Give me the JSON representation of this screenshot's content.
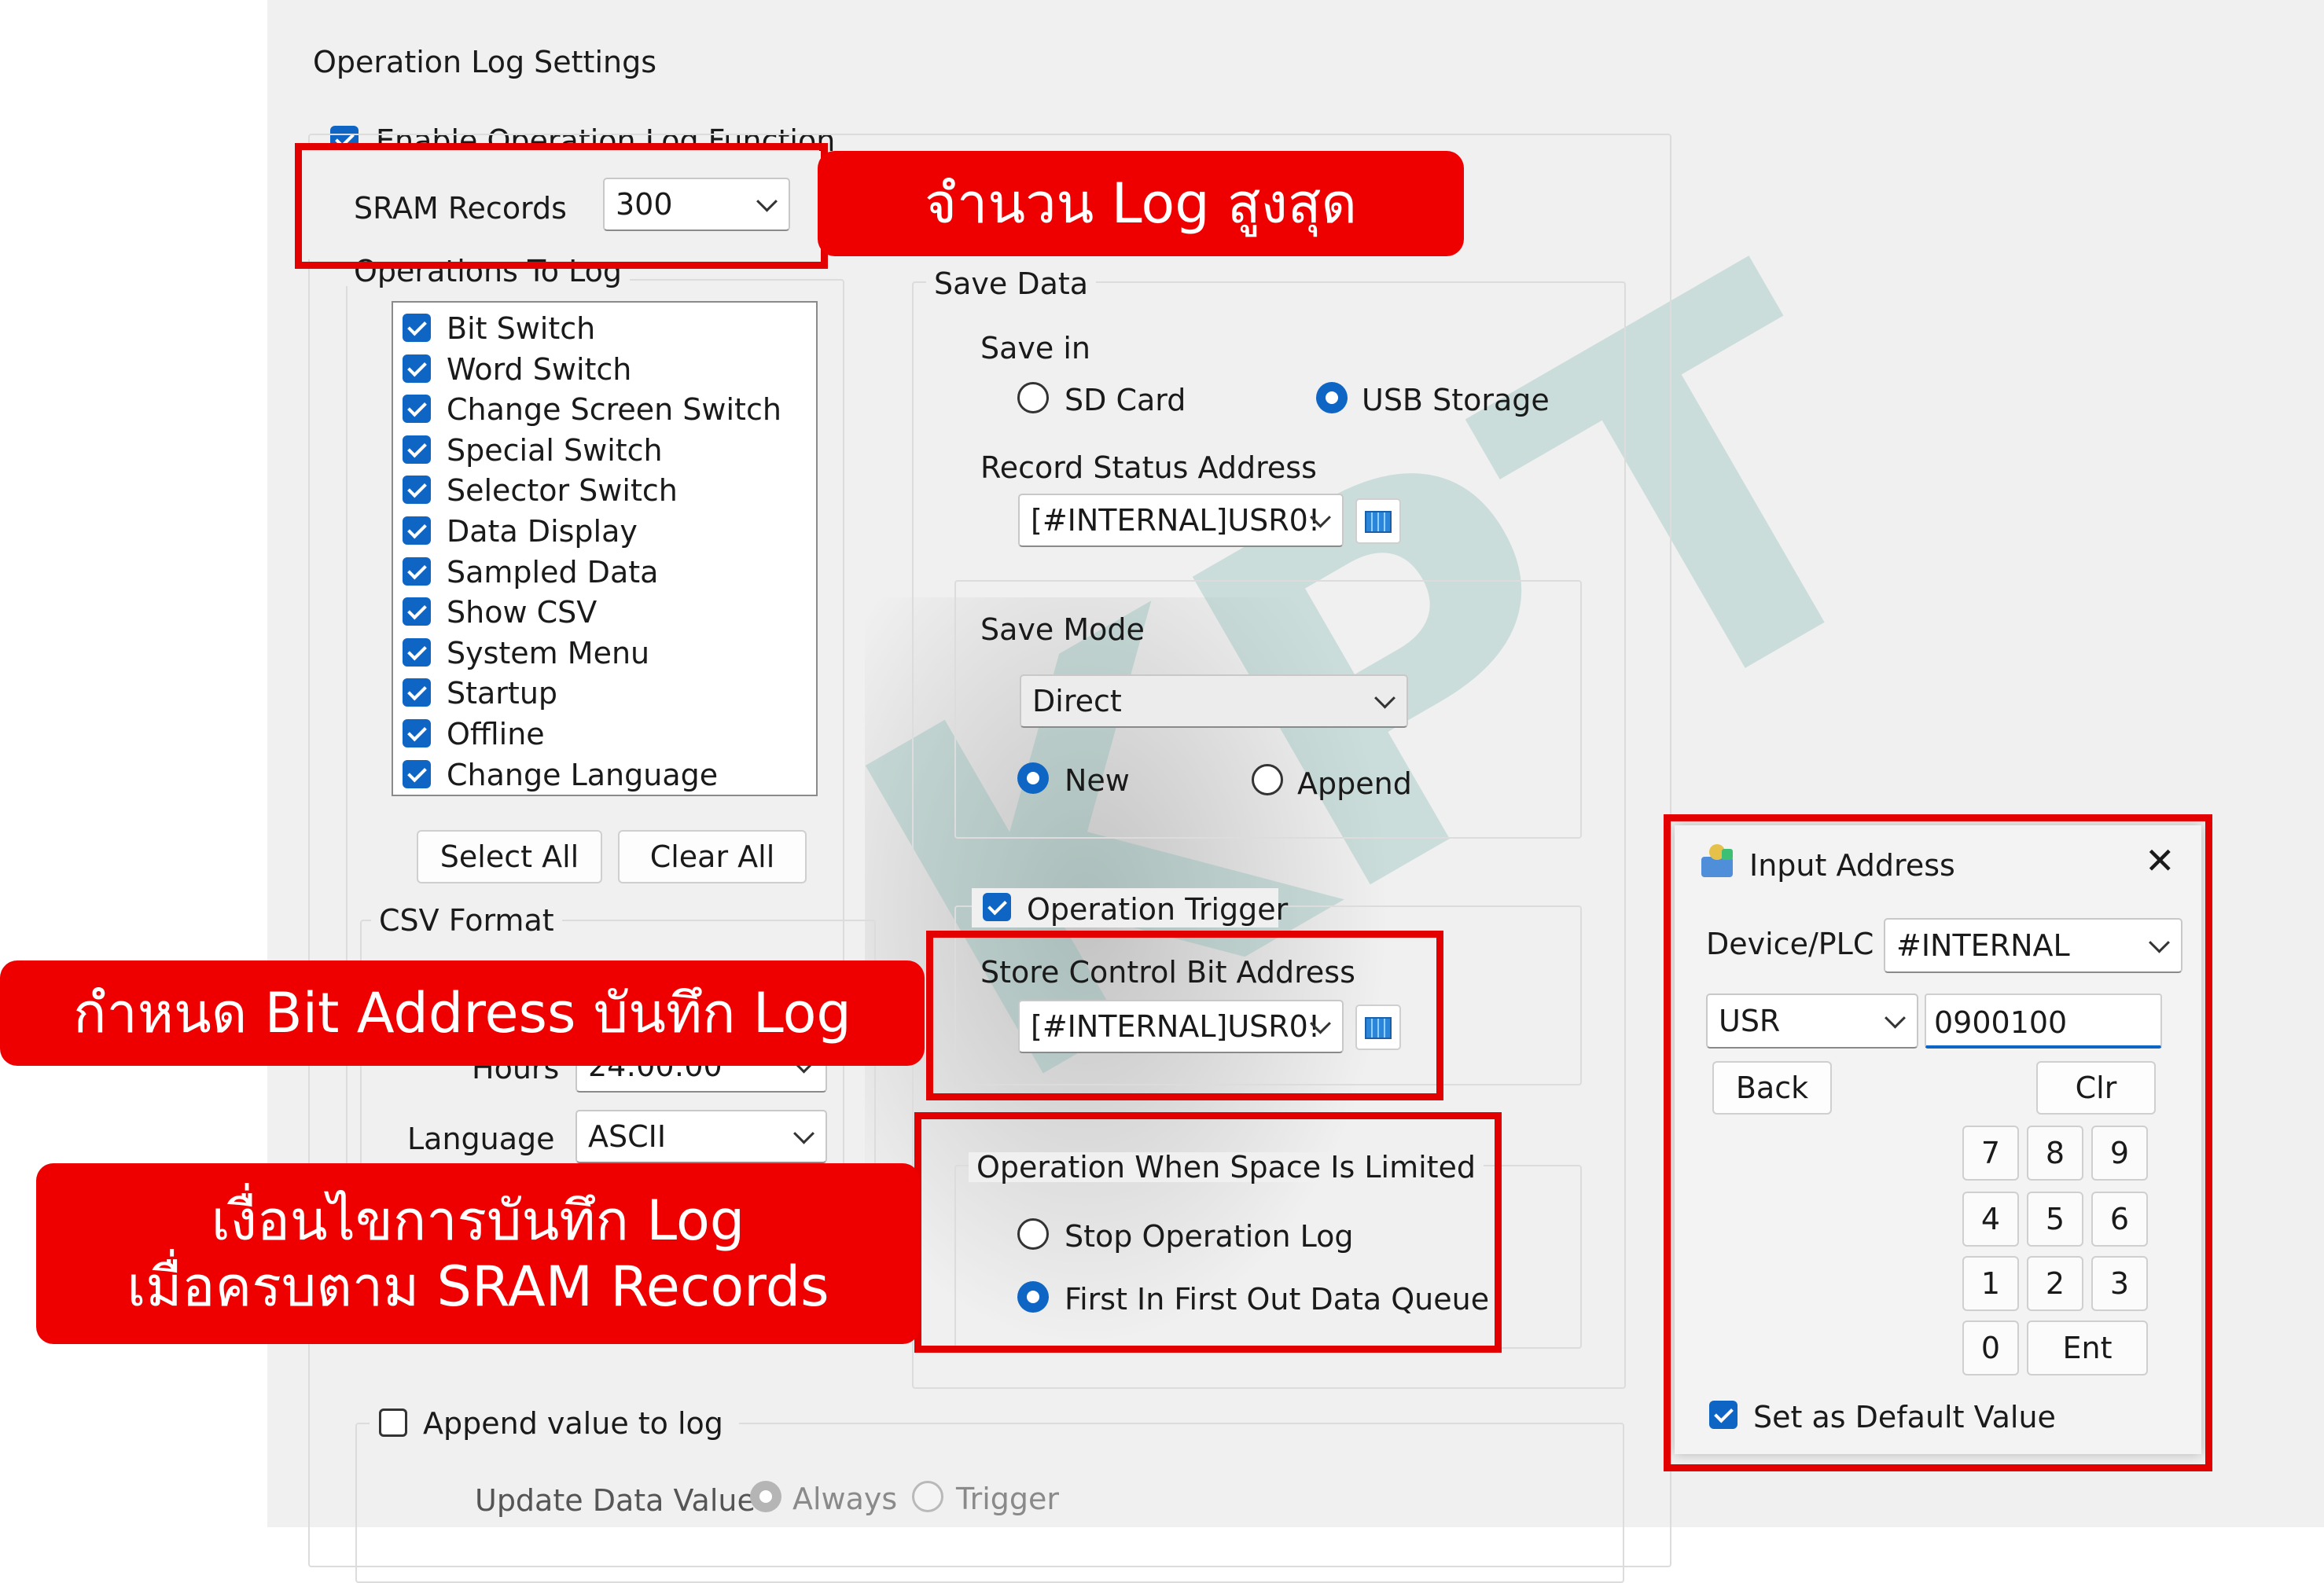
{
  "settings": {
    "title": "Operation Log Settings",
    "enable_label": "Enable Operation Log Function",
    "sram_label": "SRAM Records",
    "sram_value": "300",
    "ops_legend": "Operations To Log",
    "operations": [
      "Bit Switch",
      "Word Switch",
      "Change Screen Switch",
      "Special Switch",
      "Selector Switch",
      "Data Display",
      "Sampled Data",
      "Show CSV",
      "System Menu",
      "Startup",
      "Offline",
      "Change Language"
    ],
    "select_all": "Select All",
    "clear_all": "Clear All",
    "csv_legend": "CSV Format",
    "hours_label": "Hours",
    "hours_value": "24:00:00",
    "language_label": "Language",
    "language_value": "ASCII",
    "append_label": "Append value to log",
    "update_label": "Update Data Value",
    "update_always": "Always",
    "update_trigger": "Trigger"
  },
  "save_data": {
    "legend": "Save Data",
    "save_in_label": "Save in",
    "sd_card": "SD Card",
    "usb_storage": "USB Storage",
    "record_status_label": "Record Status Address",
    "record_status_value": "[#INTERNAL]USR0!",
    "save_mode_label": "Save Mode",
    "save_mode_value": "Direct",
    "new_label": "New",
    "append_label": "Append",
    "operation_trigger_label": "Operation Trigger",
    "store_control_label": "Store Control Bit Address",
    "store_control_value": "[#INTERNAL]USR0!",
    "space_legend": "Operation When Space Is Limited",
    "stop_label": "Stop Operation Log",
    "fifo_label": "First In First Out Data Queue"
  },
  "callouts": {
    "max_log": "จำนวน Log สูงสุด",
    "bit_address": "กำหนด Bit Address บันทึก Log",
    "condition_line1": "เงื่อนไขการบันทึก Log",
    "condition_line2": "เมื่อครบตาม SRAM Records"
  },
  "dialog": {
    "title": "Input Address",
    "close": "✕",
    "device_label": "Device/PLC",
    "device_value": "#INTERNAL",
    "type_value": "USR",
    "address_value": "0900100",
    "back": "Back",
    "clr": "Clr",
    "keys": [
      "7",
      "8",
      "9",
      "4",
      "5",
      "6",
      "1",
      "2",
      "3",
      "0"
    ],
    "ent": "Ent",
    "default_label": "Set as Default Value"
  },
  "watermark": "KPT",
  "colors": {
    "accent": "#0f65c4",
    "frame": "#e30000",
    "callout": "#ee0000"
  }
}
